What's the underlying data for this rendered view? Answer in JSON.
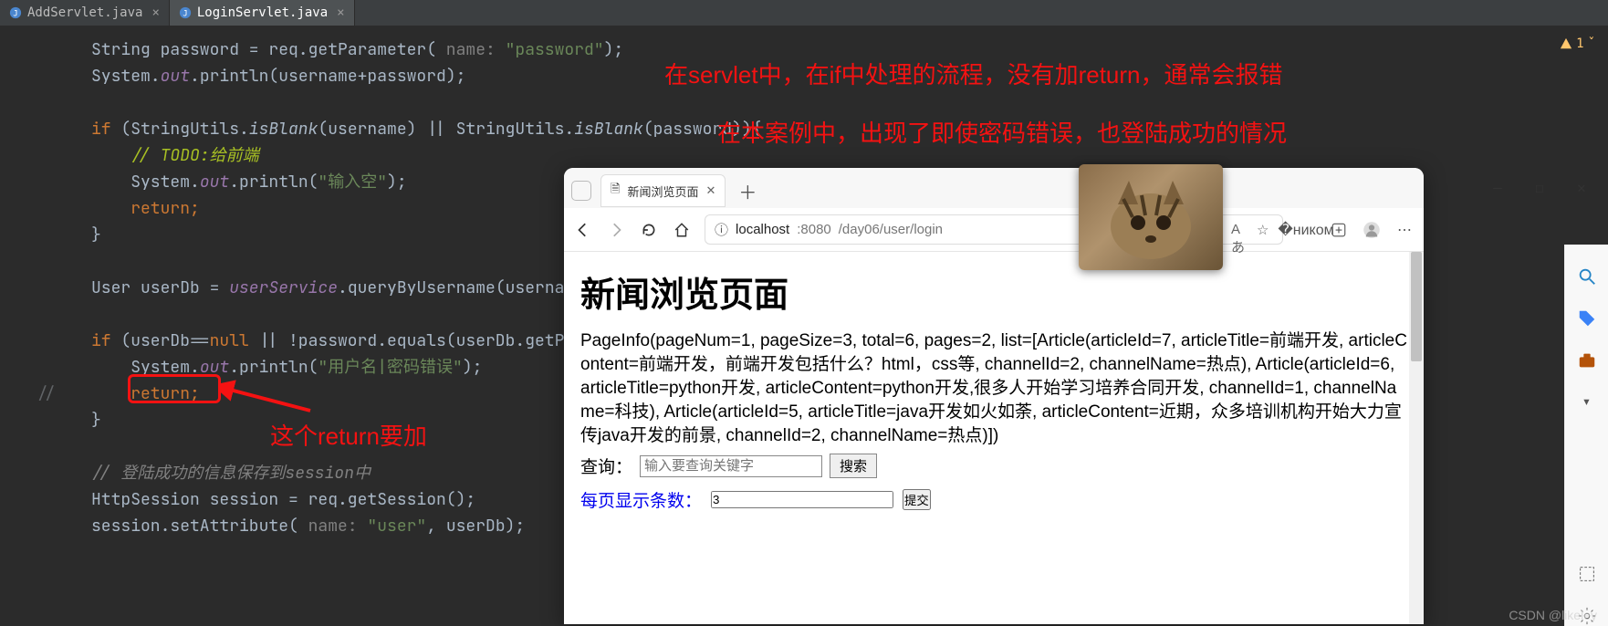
{
  "ide": {
    "tabs": [
      {
        "label": "AddServlet.java",
        "active": false
      },
      {
        "label": "LoginServlet.java",
        "active": true
      }
    ],
    "warning_count": "1",
    "gutter_comment_mark": "//",
    "code": {
      "l1_a": "String password = req.getParameter(",
      "l1_name": " name: ",
      "l1_str": "\"password\"",
      "l1_b": ");",
      "l2_a": "System.",
      "l2_out": "out",
      "l2_b": ".println(username+password);",
      "l4_a": "if",
      "l4_b": " (StringUtils.",
      "l4_isblank": "isBlank",
      "l4_c": "(username) || StringUtils.",
      "l4_d": "(password)){",
      "l5": "// TODO:给前端",
      "l6_a": "System.",
      "l6_b": ".println(",
      "l6_str": "\"输入空\"",
      "l6_c": ");",
      "l7": "return;",
      "l8": "}",
      "l10_a": "User userDb = ",
      "l10_field": "userService",
      "l10_b": ".queryByUsername(username);",
      "l12_a": "if",
      "l12_b": " (userDb==",
      "l12_null": "null",
      "l12_c": " || !password.equals(userDb.getPassword())){",
      "l13_a": "System.",
      "l13_b": ".println(",
      "l13_str": "\"用户名|密码错误\"",
      "l13_c": ");",
      "l14": "return;",
      "l15": "}",
      "l17": "// 登陆成功的信息保存到session中",
      "l18": "HttpSession session = req.getSession();",
      "l19_a": "session.setAttribute(",
      "l19_name": " name: ",
      "l19_str": "\"user\"",
      "l19_b": ", userDb);"
    }
  },
  "annotations": {
    "note1": "在servlet中，在if中处理的流程，没有加return，通常会报错",
    "note2": "在本案例中，出现了即使密码错误，也登陆成功的情况",
    "note3": "这个return要加"
  },
  "browser": {
    "tab_title": "新闻浏览页面",
    "url_host": "localhost",
    "url_port": ":8080",
    "url_path": "/day06/user/login",
    "page": {
      "heading": "新闻浏览页面",
      "body_text": "PageInfo(pageNum=1, pageSize=3, total=6, pages=2, list=[Article(articleId=7, articleTitle=前端开发, articleContent=前端开发，前端开发包括什么？html，css等, channelId=2, channelName=热点), Article(articleId=6, articleTitle=python开发, articleContent=python开发,很多人开始学习培养合同开发, channelId=1, channelName=科技), Article(articleId=5, articleTitle=java开发如火如荼, articleContent=近期，众多培训机构开始大力宣传java开发的前景, channelId=2, channelName=热点)])",
      "search_label": "查询：",
      "search_placeholder": "输入要查询关键字",
      "search_button": "搜索",
      "perpage_label": "每页显示条数：",
      "perpage_value": "3",
      "submit_button": "提交"
    }
  },
  "watermark": "CSDN @likeley"
}
